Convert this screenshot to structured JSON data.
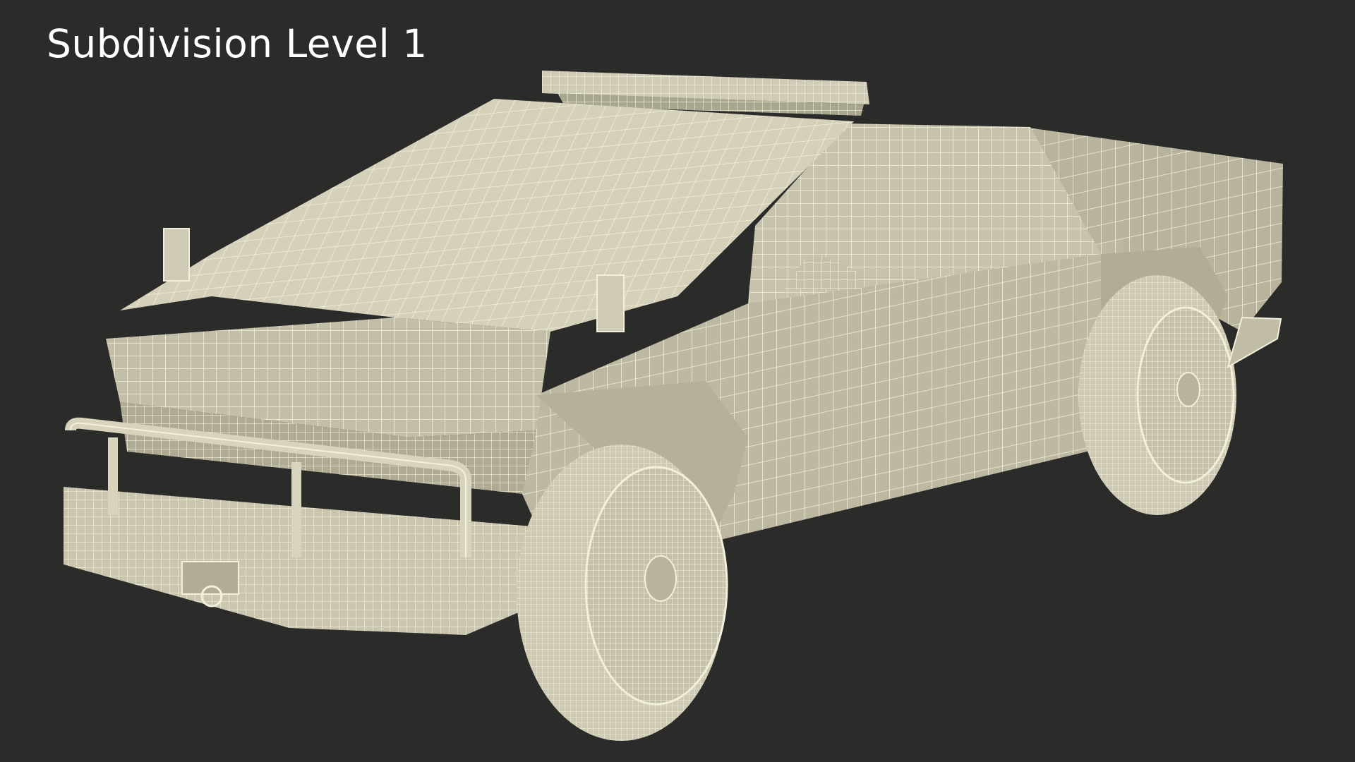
{
  "viewport": {
    "title": "Subdivision Level 1"
  },
  "colors": {
    "background": "#2b2b2a",
    "surface": "#cfcbb6",
    "surface_shadow": "#a9a690",
    "wire": "#f2efdc",
    "title_text": "#ffffff"
  }
}
